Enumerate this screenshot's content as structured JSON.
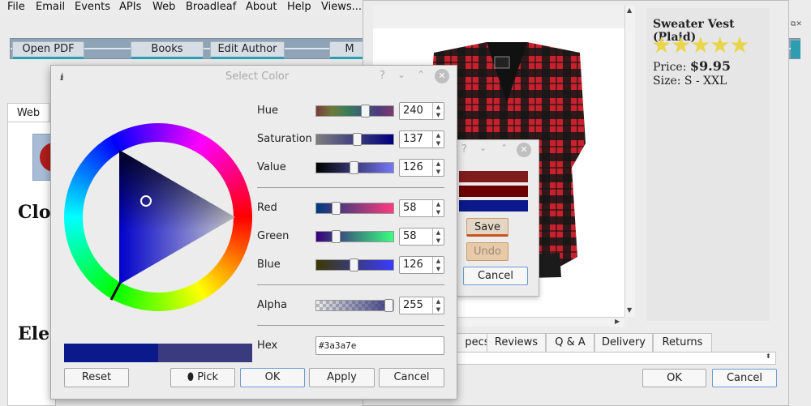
{
  "menubar": {
    "items": [
      "File",
      "Email",
      "Events",
      "APIs",
      "Web",
      "Broadleaf",
      "About",
      "Help",
      "Views..."
    ]
  },
  "toolbar": {
    "buttons": [
      "Open PDF",
      "Books",
      "Edit Author",
      "M"
    ]
  },
  "left_panel": {
    "tab": "Web",
    "heading1": "Clot",
    "heading2": "Elec"
  },
  "product": {
    "title": "Sweater Vest (Plaid)",
    "rating_stars": 5,
    "price_label": "Price:",
    "price": "$9.95",
    "size_label": "Size:",
    "size": "S - XXL",
    "tabs": [
      "pecs",
      "Reviews",
      "Q & A",
      "Delivery",
      "Returns"
    ],
    "ok_label": "OK",
    "cancel_label": "Cancel",
    "image_alt": "plaid sweater vest",
    "colors": {
      "red": "#c8202c",
      "black": "#161616"
    }
  },
  "small_dialog": {
    "help": "?",
    "swatches": [
      "#7f1d1d",
      "#6b0000",
      "#0b1a8a"
    ],
    "save_label": "Save",
    "undo_label": "Undo",
    "cancel_label": "Cancel"
  },
  "color_dialog": {
    "title": "Select Color",
    "hue_label": "Hue",
    "hue": "240",
    "hue_level": 0.65,
    "saturation_label": "Saturation",
    "saturation": "137",
    "saturation_level": 0.54,
    "value_label": "Value",
    "value": "126",
    "value_level": 0.49,
    "red_label": "Red",
    "red": "58",
    "red_level": 0.23,
    "green_label": "Green",
    "green": "58",
    "green_level": 0.23,
    "blue_label": "Blue",
    "blue": "126",
    "blue_level": 0.49,
    "alpha_label": "Alpha",
    "alpha": "255",
    "alpha_level": 1.0,
    "hex_label": "Hex",
    "hex": "#3a3a7e",
    "old_color": "#0b1a8a",
    "new_color": "#3a3a7e",
    "reset_label": "Reset",
    "pick_label": "Pick",
    "ok_label": "OK",
    "apply_label": "Apply",
    "cancel_label": "Cancel"
  }
}
